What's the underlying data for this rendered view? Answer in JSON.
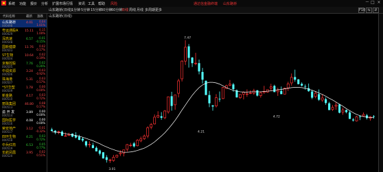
{
  "menubar": {
    "items": [
      "系统",
      "功能",
      "报价",
      "分析",
      "扩展市场行情",
      "资讯",
      "工具",
      "帮助"
    ],
    "promo_label": "风险",
    "right_promo_1": "通达信金融终端",
    "right_promo_2": "山东路桥",
    "win_buttons": [
      "－",
      "□",
      "×"
    ]
  },
  "toolbar": {
    "tabs": [
      "山东路桥(日线)",
      "1分钟",
      "5分钟",
      "15分钟",
      "30分钟",
      "60分钟",
      "日线",
      "周线",
      "月线",
      "多周期",
      "更多"
    ],
    "active_tab_index": 6,
    "right_controls": [
      "F10",
      "⇆",
      "⇵"
    ]
  },
  "watchlist": {
    "headers": [
      "代码名称",
      "最新",
      "涨跌"
    ],
    "rows": [
      {
        "name": "山东路桥",
        "code": "000498",
        "price": "4.01",
        "change": "0.04",
        "pct": "1.01%",
        "name_color": "#ffffff",
        "price_color": "#ff4d4d",
        "change_color": "#ff4d4d",
        "selected": true
      },
      {
        "name": "粤运通股A",
        "code": "000429",
        "price": "15.11",
        "change": "0.15",
        "pct": "1.00%",
        "name_color": "#e6c200",
        "price_color": "#ff4d4d",
        "change_color": "#ff4d4d",
        "selected": false
      },
      {
        "name": "深高速",
        "code": "000548",
        "price": "6.57",
        "change": "-0.01",
        "pct": "-0.15%",
        "name_color": "#e6c200",
        "price_color": "#33cc33",
        "change_color": "#33cc33",
        "selected": false
      },
      {
        "name": "国新健康",
        "code": "000503",
        "price": "11.76",
        "change": "0.02",
        "pct": "0.17%",
        "name_color": "#e6c200",
        "price_color": "#ff4d4d",
        "change_color": "#ff4d4d",
        "selected": false
      },
      {
        "name": "ST生物",
        "code": "000504",
        "price": "10.64",
        "change": "0.02",
        "pct": "0.19%",
        "name_color": "#e6c200",
        "price_color": "#ff4d4d",
        "change_color": "#ff4d4d",
        "selected": false
      },
      {
        "name": "京粮控股",
        "code": "000505",
        "price": "7.76",
        "change": "0.02",
        "pct": "0.26%",
        "name_color": "#e6c200",
        "price_color": "#33cc33",
        "change_color": "#33cc33",
        "selected": false
      },
      {
        "name": "中润资源",
        "code": "000506",
        "price": "3.24",
        "change": "-0.03",
        "pct": "-0.92%",
        "name_color": "#e6c200",
        "price_color": "#ff4d4d",
        "change_color": "#ff4d4d",
        "selected": false
      },
      {
        "name": "珠海港",
        "code": "000507",
        "price": "5.31",
        "change": "0.03",
        "pct": "0.57%",
        "name_color": "#e6c200",
        "price_color": "#ff4d4d",
        "change_color": "#ff4d4d",
        "selected": false
      },
      {
        "name": "*ST华塑",
        "code": "000509",
        "price": "1.78",
        "change": "0.00",
        "pct": "0.00%",
        "name_color": "#e6c200",
        "price_color": "#ff4d4d",
        "change_color": "#ff4d4d",
        "selected": false
      },
      {
        "name": "新金路",
        "code": "000510",
        "price": "4.17",
        "change": "0.03",
        "pct": "0.72%",
        "name_color": "#e6c200",
        "price_color": "#ff4d4d",
        "change_color": "#ff4d4d",
        "selected": false
      },
      {
        "name": "丽珠集团",
        "code": "000513",
        "price": "46.80",
        "change": "0.08",
        "pct": "0.17%",
        "name_color": "#e6c200",
        "price_color": "#ff4d4d",
        "change_color": "#ff4d4d",
        "selected": false
      },
      {
        "name": "渝 开 发",
        "code": "000514",
        "price": "3.89",
        "change": "0.00",
        "pct": "0.00%",
        "name_color": "#ffffff",
        "price_color": "#ffffff",
        "change_color": "#ffffff",
        "selected": false
      },
      {
        "name": "国际医学",
        "code": "000516",
        "price": "4.08",
        "change": "0.00",
        "pct": "0.00%",
        "name_color": "#e6c200",
        "price_color": "#ffffff",
        "change_color": "#ffffff",
        "selected": false
      },
      {
        "name": "荣安地产",
        "code": "000517",
        "price": "3.12",
        "change": "-0.01",
        "pct": "-0.32%",
        "name_color": "#e6c200",
        "price_color": "#ff4d4d",
        "change_color": "#ff4d4d",
        "selected": false
      },
      {
        "name": "四环生物",
        "code": "000518",
        "price": "4.21",
        "change": "0.03",
        "pct": "0.72%",
        "name_color": "#e6c200",
        "price_color": "#33cc33",
        "change_color": "#33cc33",
        "selected": false
      },
      {
        "name": "中兵红箭",
        "code": "000519",
        "price": "6.53",
        "change": "0.05",
        "pct": "0.77%",
        "name_color": "#e6c200",
        "price_color": "#33cc33",
        "change_color": "#33cc33",
        "selected": false
      },
      {
        "name": "长航凤凰",
        "code": "000520",
        "price": "3.95",
        "change": "0.02",
        "pct": "0.51%",
        "name_color": "#e6c200",
        "price_color": "#ff4d4d",
        "change_color": "#ff4d4d",
        "selected": false
      }
    ]
  },
  "chart_header": {
    "title": "山东路桥(日线)"
  },
  "chart_data": {
    "type": "candlestick",
    "up_color": "#ff3232",
    "down_color": "#54ffff",
    "ma_color": "#ffffff",
    "candles": [
      [
        4.27,
        4.33,
        4.22,
        4.22
      ],
      [
        4.23,
        4.25,
        4.11,
        4.17
      ],
      [
        4.18,
        4.23,
        4.11,
        4.2
      ],
      [
        4.2,
        4.24,
        4.05,
        4.06
      ],
      [
        4.06,
        4.17,
        4.05,
        4.06
      ],
      [
        4.07,
        4.16,
        4.05,
        4.1
      ],
      [
        4.13,
        4.14,
        4.01,
        4.03
      ],
      [
        4.07,
        4.18,
        3.97,
        4.0
      ],
      [
        4.03,
        4.09,
        3.91,
        3.92
      ],
      [
        3.96,
        4.01,
        3.85,
        3.9
      ],
      [
        3.87,
        3.89,
        3.67,
        3.73
      ],
      [
        3.76,
        3.87,
        3.66,
        3.77
      ],
      [
        3.74,
        3.82,
        3.64,
        3.64
      ],
      [
        3.65,
        3.7,
        3.53,
        3.53
      ],
      [
        3.56,
        3.59,
        3.39,
        3.45
      ],
      [
        3.5,
        3.5,
        3.29,
        3.29
      ],
      [
        3.33,
        3.4,
        3.15,
        3.24
      ],
      [
        3.24,
        3.28,
        3.14,
        3.24
      ],
      [
        3.22,
        3.41,
        3.18,
        3.33
      ],
      [
        3.34,
        3.42,
        3.31,
        3.4
      ],
      [
        3.45,
        3.57,
        3.37,
        3.48
      ],
      [
        3.47,
        3.58,
        3.36,
        3.58
      ],
      [
        3.6,
        3.78,
        3.52,
        3.76
      ],
      [
        3.73,
        3.82,
        3.68,
        3.74
      ],
      [
        3.8,
        3.85,
        3.66,
        3.7
      ],
      [
        3.72,
        3.94,
        3.7,
        3.91
      ],
      [
        3.89,
        4.03,
        3.84,
        3.95
      ],
      [
        3.96,
        4.1,
        3.92,
        4.05
      ],
      [
        4.05,
        4.38,
        3.98,
        4.33
      ],
      [
        4.35,
        4.49,
        4.28,
        4.44
      ],
      [
        4.46,
        4.78,
        4.44,
        4.69
      ],
      [
        4.69,
        4.89,
        4.66,
        4.75
      ],
      [
        4.72,
        4.86,
        4.6,
        4.67
      ],
      [
        4.67,
        4.93,
        4.62,
        4.9
      ],
      [
        4.87,
        5.39,
        4.81,
        5.38
      ],
      [
        5.4,
        5.55,
        4.91,
        5.07
      ],
      [
        5.11,
        5.44,
        4.94,
        5.44
      ],
      [
        5.5,
        5.99,
        5.36,
        5.92
      ],
      [
        5.99,
        6.62,
        5.9,
        6.59
      ],
      [
        6.59,
        7.3,
        6.46,
        7.06
      ],
      [
        7.09,
        7.17,
        6.37,
        6.7
      ],
      [
        6.71,
        6.73,
        6.39,
        6.52
      ],
      [
        6.52,
        6.87,
        6.45,
        6.52
      ],
      [
        6.52,
        6.64,
        6.14,
        6.24
      ],
      [
        6.22,
        6.36,
        5.83,
        5.96
      ],
      [
        5.92,
        5.94,
        5.44,
        5.44
      ],
      [
        5.44,
        5.58,
        5.03,
        5.16
      ],
      [
        5.09,
        5.1,
        4.91,
        5.05
      ],
      [
        5.07,
        5.47,
        5.02,
        5.35
      ],
      [
        5.31,
        5.56,
        5.21,
        5.29
      ],
      [
        5.32,
        5.71,
        5.3,
        5.7
      ],
      [
        5.66,
        5.79,
        5.65,
        5.76
      ],
      [
        5.77,
        5.95,
        5.74,
        5.81
      ],
      [
        5.8,
        5.85,
        5.55,
        5.64
      ],
      [
        5.6,
        5.63,
        5.35,
        5.36
      ],
      [
        5.35,
        5.47,
        5.31,
        5.46
      ],
      [
        5.47,
        5.57,
        5.29,
        5.54
      ],
      [
        5.48,
        5.63,
        5.38,
        5.48
      ],
      [
        5.5,
        5.6,
        5.47,
        5.51
      ],
      [
        5.5,
        5.65,
        5.45,
        5.59
      ],
      [
        5.6,
        5.61,
        5.39,
        5.42
      ],
      [
        5.42,
        5.56,
        5.35,
        5.52
      ],
      [
        5.53,
        5.75,
        5.48,
        5.56
      ],
      [
        5.54,
        5.62,
        5.52,
        5.62
      ],
      [
        5.67,
        5.82,
        5.59,
        5.72
      ],
      [
        5.75,
        5.79,
        5.54,
        5.54
      ],
      [
        5.55,
        5.69,
        5.41,
        5.6
      ],
      [
        5.58,
        5.73,
        5.47,
        5.47
      ],
      [
        5.47,
        5.69,
        5.47,
        5.67
      ],
      [
        5.68,
        5.89,
        5.58,
        5.82
      ],
      [
        5.85,
        6.17,
        5.76,
        6.04
      ],
      [
        6.05,
        6.3,
        5.89,
        5.96
      ],
      [
        5.97,
        5.98,
        5.8,
        5.81
      ],
      [
        5.82,
        5.87,
        5.73,
        5.76
      ],
      [
        5.74,
        5.8,
        5.62,
        5.73
      ],
      [
        5.67,
        5.83,
        5.55,
        5.57
      ],
      [
        5.56,
        5.62,
        5.3,
        5.35
      ],
      [
        5.39,
        5.56,
        5.33,
        5.5
      ],
      [
        5.47,
        5.63,
        5.24,
        5.28
      ],
      [
        5.27,
        5.46,
        5.21,
        5.34
      ],
      [
        5.3,
        5.36,
        5.11,
        5.17
      ],
      [
        5.16,
        5.21,
        4.93,
        4.93
      ],
      [
        4.95,
        5.1,
        4.9,
        5.02
      ],
      [
        5.06,
        5.21,
        4.94,
        5.1
      ],
      [
        5.12,
        5.14,
        4.82,
        4.84
      ],
      [
        4.86,
        5.01,
        4.77,
        4.93
      ],
      [
        4.93,
        4.95,
        4.82,
        4.86
      ],
      [
        4.85,
        4.9,
        4.63,
        4.63
      ],
      [
        4.61,
        4.66,
        4.54,
        4.58
      ],
      [
        4.56,
        4.73,
        4.54,
        4.7
      ],
      [
        4.71,
        4.76,
        4.59,
        4.7
      ],
      [
        4.73,
        4.85,
        4.71,
        4.78
      ],
      [
        4.75,
        4.8,
        4.61,
        4.66
      ],
      [
        4.65,
        4.73,
        4.57,
        4.7
      ],
      [
        4.72,
        4.76,
        4.64,
        4.7
      ]
    ],
    "ma": [
      4.2,
      4.18,
      4.17,
      4.15,
      4.13,
      4.11,
      4.09,
      4.07,
      4.04,
      4.01,
      3.97,
      3.93,
      3.89,
      3.84,
      3.79,
      3.73,
      3.68,
      3.63,
      3.59,
      3.55,
      3.52,
      3.5,
      3.5,
      3.51,
      3.53,
      3.56,
      3.6,
      3.64,
      3.7,
      3.77,
      3.85,
      3.95,
      4.05,
      4.16,
      4.29,
      4.43,
      4.58,
      4.75,
      4.93,
      5.1,
      5.27,
      5.43,
      5.57,
      5.69,
      5.78,
      5.84,
      5.87,
      5.87,
      5.85,
      5.81,
      5.75,
      5.69,
      5.64,
      5.6,
      5.57,
      5.55,
      5.54,
      5.54,
      5.55,
      5.55,
      5.55,
      5.55,
      5.56,
      5.57,
      5.58,
      5.6,
      5.62,
      5.63,
      5.65,
      5.67,
      5.69,
      5.7,
      5.7,
      5.69,
      5.67,
      5.64,
      5.6,
      5.56,
      5.51,
      5.46,
      5.4,
      5.33,
      5.27,
      5.2,
      5.13,
      5.06,
      4.98,
      4.91,
      4.84,
      4.78,
      4.74,
      4.71,
      4.69,
      4.68,
      4.67
    ],
    "annotations": [
      {
        "text": "3.01",
        "index": 16,
        "price": 2.95
      },
      {
        "text": "4.21",
        "index": 42,
        "price": 4.21
      },
      {
        "text": "7.47",
        "index": 38,
        "price": 7.4
      },
      {
        "text": "4.72",
        "index": 64,
        "price": 4.72
      }
    ]
  }
}
